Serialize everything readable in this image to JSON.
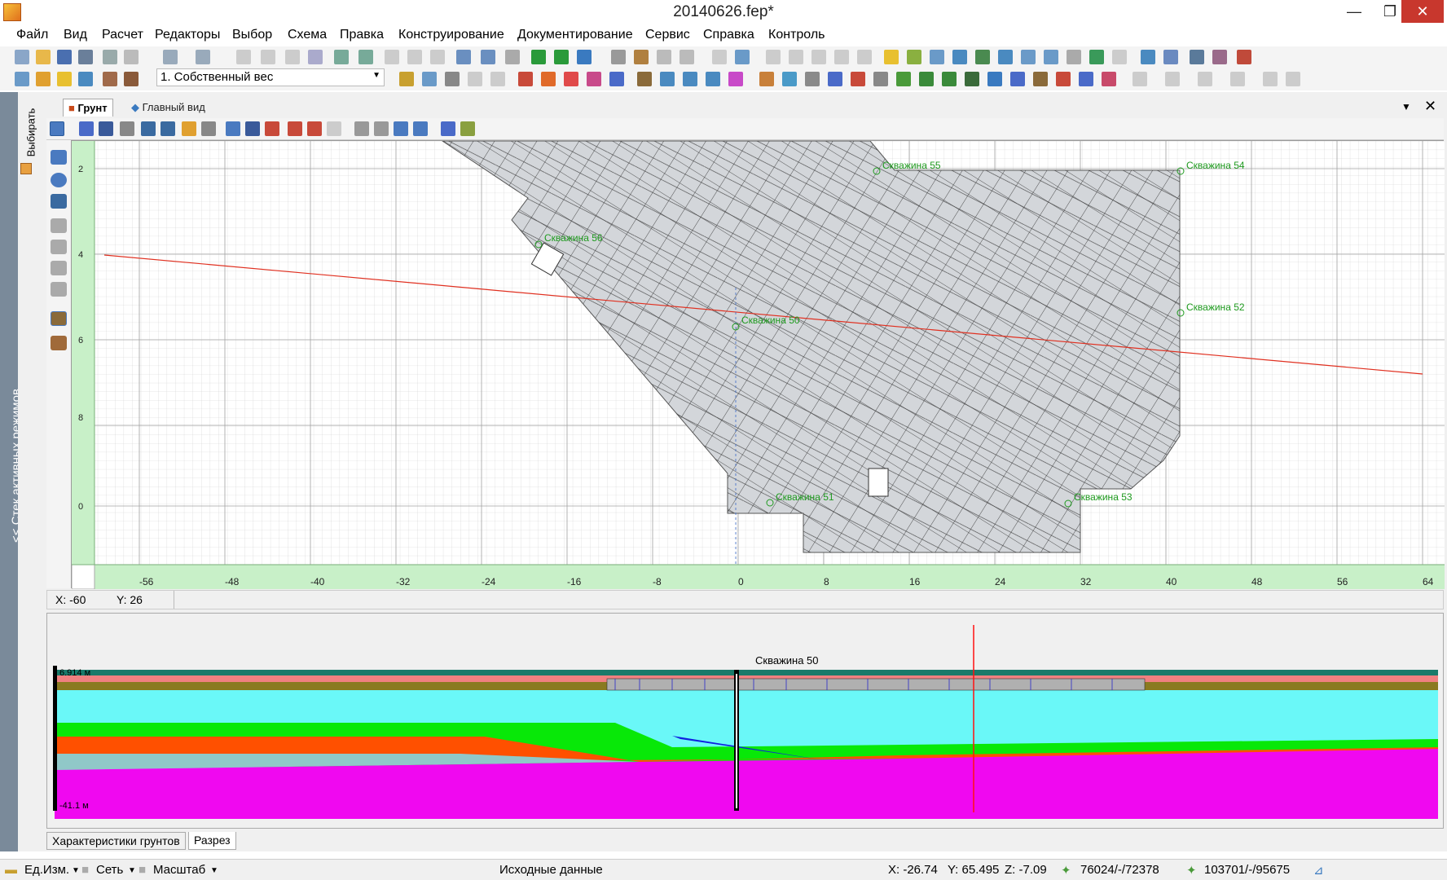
{
  "title": "20140626.fep*",
  "menu": [
    "Файл",
    "Вид",
    "Расчет",
    "Редакторы",
    "Выбор",
    "Схема",
    "Правка",
    "Конструирование",
    "Документирование",
    "Сервис",
    "Справка",
    "Контроль"
  ],
  "layer_select": "1. Собственный вес",
  "side_panel": {
    "stack_label": "<< Стек активных режимов",
    "choose_label": "Выбирать"
  },
  "doc_tabs": {
    "grunt": "Грунт",
    "main": "Главный вид"
  },
  "plan": {
    "x_ticks": [
      "-56",
      "-48",
      "-40",
      "-32",
      "-24",
      "-16",
      "-8",
      "0",
      "8",
      "16",
      "24",
      "32",
      "40",
      "48",
      "56",
      "64"
    ],
    "y_ticks": [
      "2",
      "4",
      "6",
      "8",
      "0"
    ],
    "wells": [
      "Скважина 55",
      "Скважина 54",
      "Скважина 52",
      "Скважина 50",
      "Скважина 51",
      "Скважина 53",
      "Скважина 56"
    ]
  },
  "coords": {
    "x": "X:  -60",
    "y": "Y:  26"
  },
  "section": {
    "well_label": "Скважина 50",
    "top_level": "6.914 м",
    "bottom_level": "-41.1 м"
  },
  "bottom_tabs": {
    "soils": "Характеристики грунтов",
    "section": "Разрез"
  },
  "status": {
    "units": "Ед.Изм.",
    "grid": "Сеть",
    "scale": "Масштаб",
    "mode": "Исходные данные",
    "x": "X:  -26.74",
    "y": "Y:  65.495",
    "z": "Z:  -7.09",
    "count1": "76024/-/72378",
    "count2": "103701/-/95675"
  },
  "colors": {
    "mesh_fill": "#d3d6da",
    "grid_bg": "#c8f0c8",
    "section_line": "#e03020",
    "well_label": "#1e9a1e"
  }
}
